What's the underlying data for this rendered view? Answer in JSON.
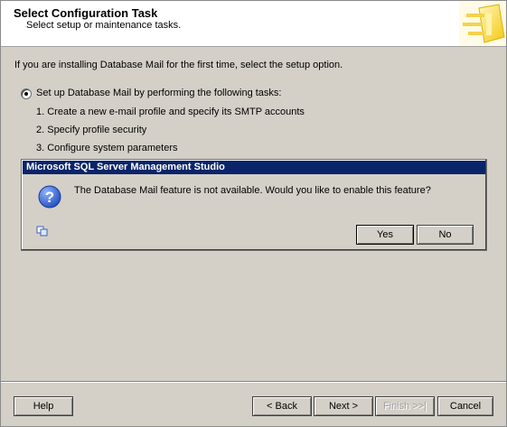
{
  "header": {
    "title": "Select Configuration Task",
    "subtitle": "Select setup or maintenance tasks."
  },
  "content": {
    "intro": "If you are installing Database Mail for the first time, select the setup option.",
    "option_label": "Set up Database Mail by performing the following tasks:",
    "option_selected": true,
    "tasks": [
      "1. Create a new e-mail profile and specify its SMTP accounts",
      "2. Specify profile security",
      "3. Configure system parameters"
    ]
  },
  "dialog": {
    "title": "Microsoft SQL Server Management Studio",
    "message": "The Database Mail feature is not available.  Would you like to enable this feature?",
    "icon": "question-icon",
    "yes_label": "Yes",
    "no_label": "No"
  },
  "footer": {
    "help_label": "Help",
    "back_label": "< Back",
    "next_label": "Next >",
    "finish_label": "Finish >>|",
    "cancel_label": "Cancel"
  },
  "colors": {
    "titlebar": "#0a246a",
    "dialog_bg": "#d4d0c8",
    "question_icon": "#2a56c6"
  }
}
